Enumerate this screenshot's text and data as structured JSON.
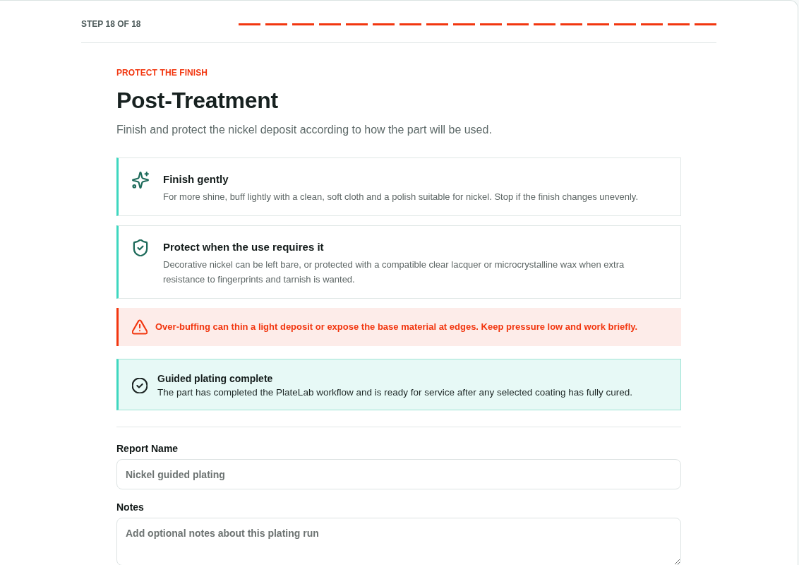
{
  "header": {
    "step_label": "STEP 18 OF 18",
    "steps": [
      {
        "completed": true
      },
      {
        "completed": true
      },
      {
        "completed": true
      },
      {
        "completed": true
      },
      {
        "completed": true
      },
      {
        "completed": true
      },
      {
        "completed": true
      },
      {
        "completed": true
      },
      {
        "completed": true
      },
      {
        "completed": true
      },
      {
        "completed": true
      },
      {
        "completed": true
      },
      {
        "completed": true
      },
      {
        "completed": true
      },
      {
        "completed": true
      },
      {
        "completed": true
      },
      {
        "completed": true
      },
      {
        "completed": true
      }
    ]
  },
  "intro": {
    "eyebrow": "PROTECT THE FINISH",
    "title": "Post-Treatment",
    "subtitle": "Finish and protect the nickel deposit according to how the part will be used."
  },
  "tips": [
    {
      "title": "Finish gently",
      "text": "For more shine, buff lightly with a clean, soft cloth and a polish suitable for nickel. Stop if the finish changes unevenly."
    },
    {
      "title": "Protect when the use requires it",
      "text": "Decorative nickel can be left bare, or protected with a compatible clear lacquer or microcrystalline wax when extra resistance to fingerprints and tarnish is wanted."
    }
  ],
  "notices": [
    {
      "kind": "warning",
      "text": "Over-buffing can thin a light deposit or expose the base material at edges. Keep pressure low and work briefly."
    },
    {
      "kind": "success",
      "title": "Guided plating complete",
      "text": "The part has completed the PlateLab workflow and is ready for service after any selected coating has fully cured."
    }
  ],
  "form": {
    "fields": [
      {
        "kind": "input",
        "label": "Report Name",
        "placeholder": "Nickel guided plating"
      },
      {
        "kind": "textarea",
        "label": "Notes",
        "placeholder": "Add optional notes about this plating run"
      }
    ]
  }
}
